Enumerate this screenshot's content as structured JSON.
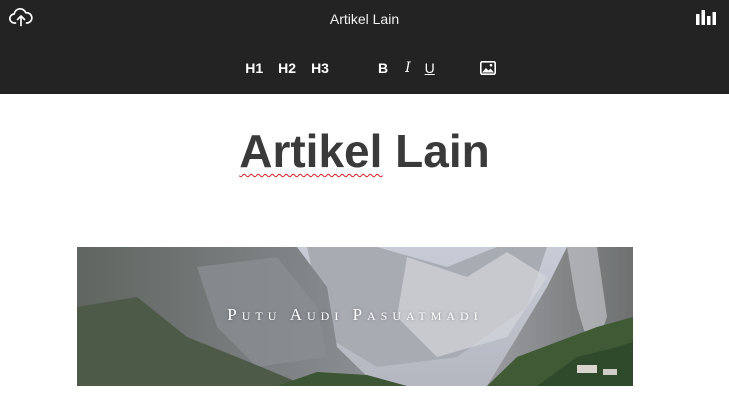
{
  "toolbar": {
    "title": "Artikel Lain",
    "upload_icon": "cloud-upload-icon",
    "stats_icon": "bar-chart-icon",
    "format": {
      "h1": "H1",
      "h2": "H2",
      "h3": "H3",
      "bold": "B",
      "italic": "I",
      "underline": "U",
      "image_icon": "image-icon"
    }
  },
  "document": {
    "heading_first": "Artikel",
    "heading_rest": " Lain",
    "banner_text": "Putu Audi Pasuatmadi"
  },
  "colors": {
    "toolbar_bg": "#232323",
    "heading": "#3a3a3a",
    "spellcheck": "#d02020"
  }
}
